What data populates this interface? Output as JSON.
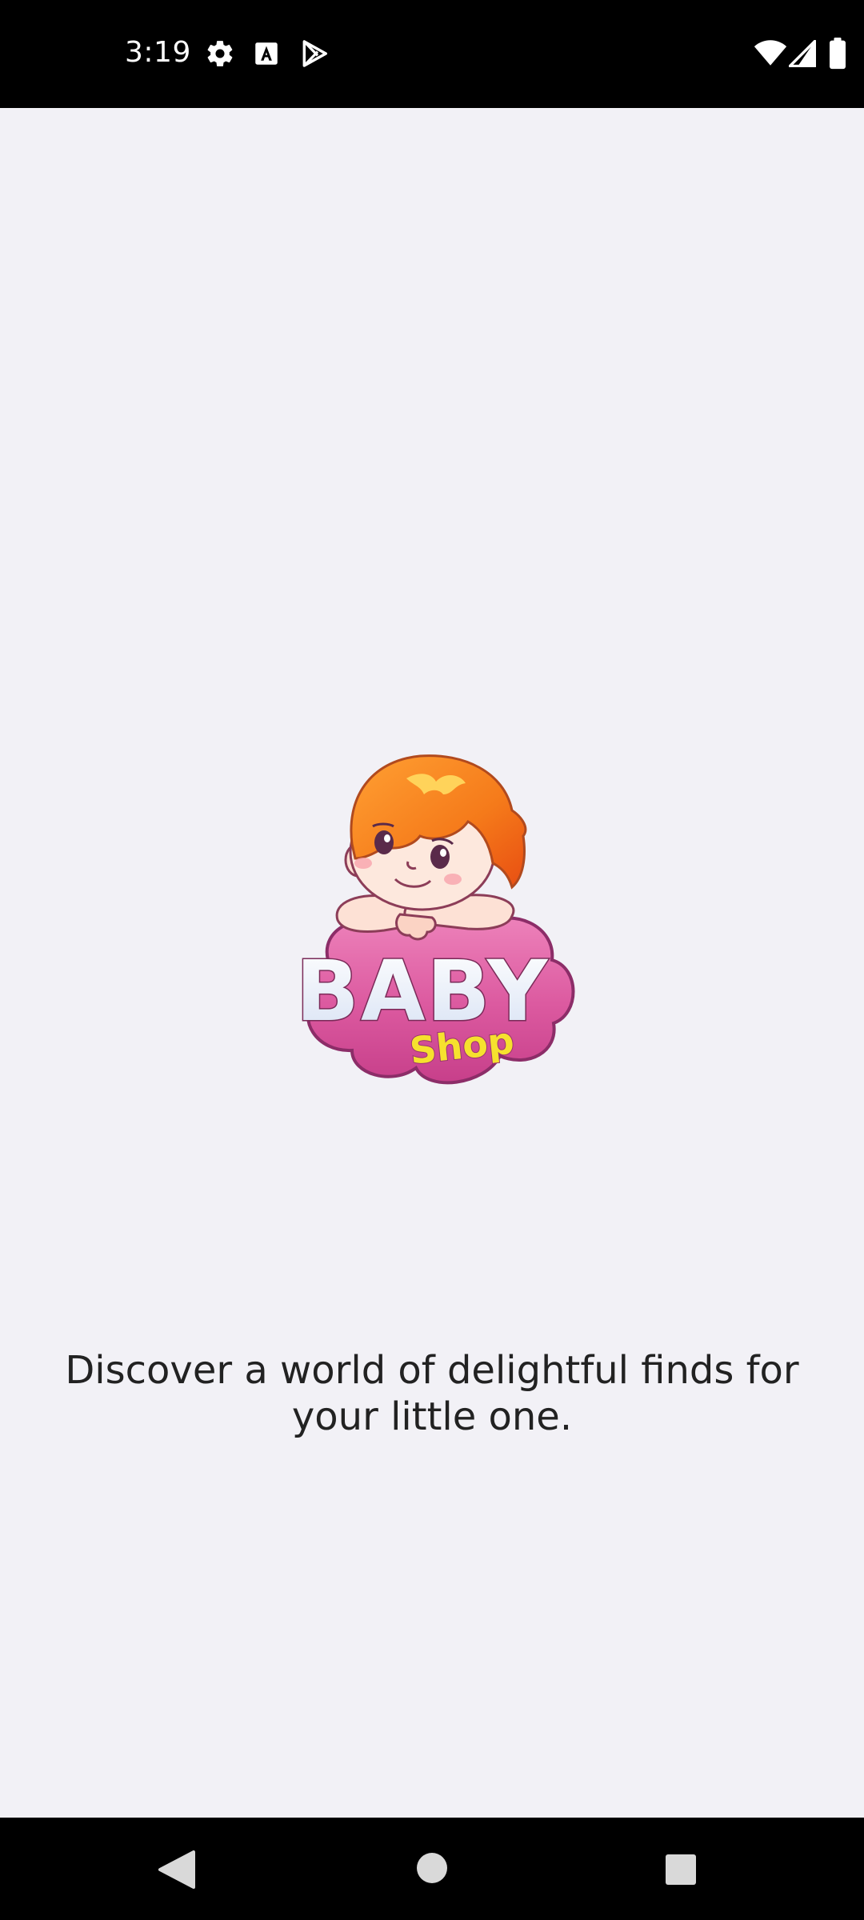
{
  "status_bar": {
    "time": "3:19",
    "icons": [
      "gear-icon",
      "font-a-icon",
      "play-store-icon",
      "wifi-icon",
      "cellular-signal-icon",
      "battery-icon"
    ]
  },
  "splash": {
    "logo": {
      "word_main": "BABY",
      "word_sub": "Shop"
    },
    "tagline": "Discover a world of delightful finds for your little one."
  },
  "nav_bar": {
    "buttons": [
      "back-icon",
      "home-icon",
      "recents-icon"
    ]
  },
  "colors": {
    "background": "#f2f1f6",
    "system_bars": "#000000",
    "logo_pink": "#d9559c",
    "logo_hair": "#f47a1f",
    "logo_shop_text": "#f6e12e",
    "text_dark": "#222222"
  }
}
